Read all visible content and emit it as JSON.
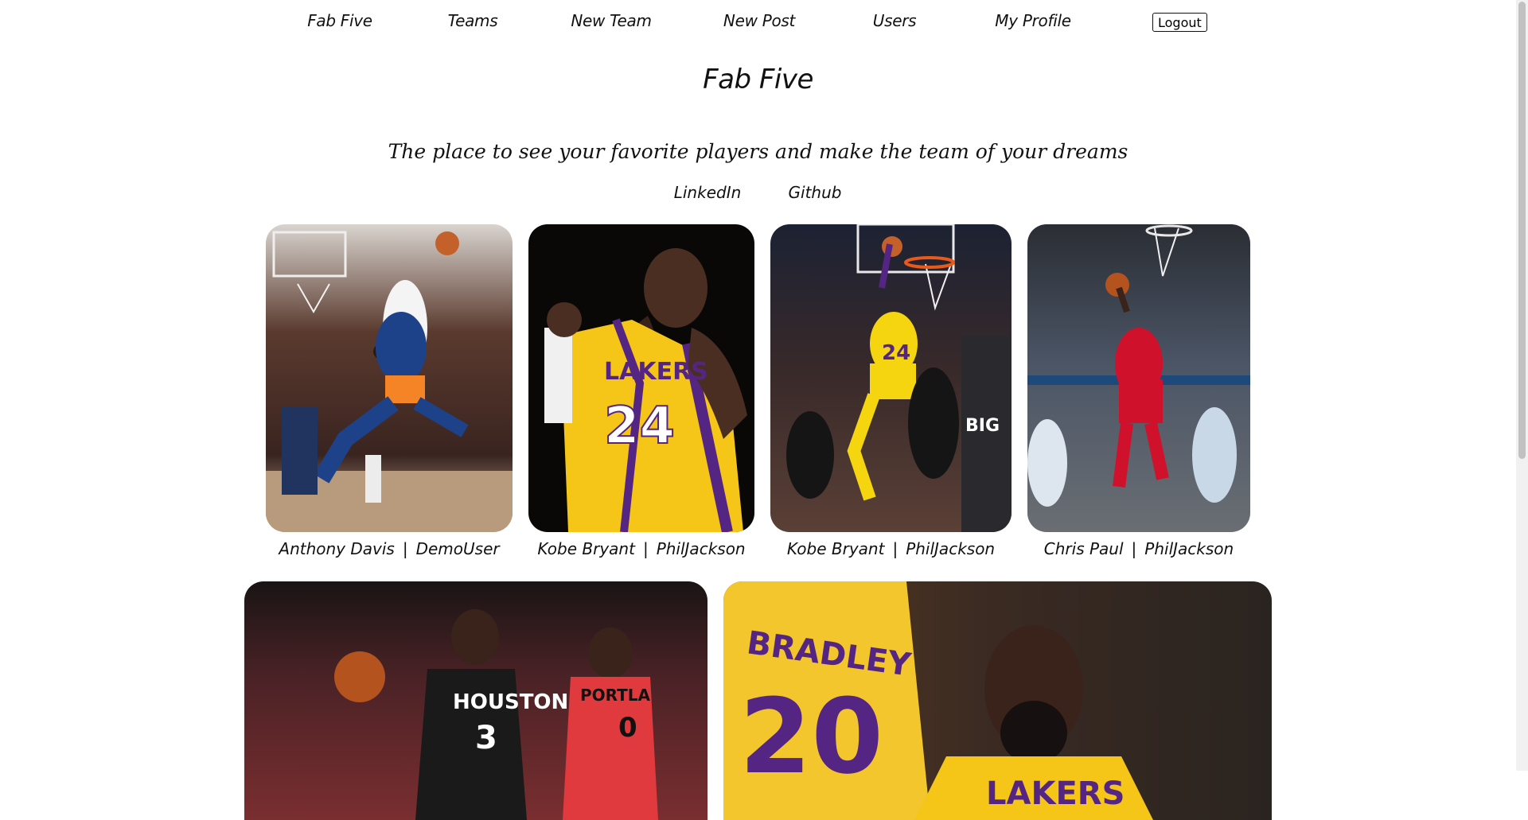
{
  "nav": {
    "items": [
      {
        "label": "Fab Five"
      },
      {
        "label": "Teams"
      },
      {
        "label": "New Team"
      },
      {
        "label": "New Post"
      },
      {
        "label": "Users"
      },
      {
        "label": "My Profile"
      }
    ],
    "logout_label": "Logout"
  },
  "header": {
    "title": "Fab Five",
    "tagline": "The place to see your favorite players and make the team of your dreams"
  },
  "links": {
    "linkedin": "LinkedIn",
    "github": "Github"
  },
  "separator": "|",
  "posts": [
    {
      "player": "Anthony Davis",
      "user": "DemoUser",
      "icon": "player-photo-icon"
    },
    {
      "player": "Kobe Bryant",
      "user": "PhilJackson",
      "icon": "player-photo-icon"
    },
    {
      "player": "Kobe Bryant",
      "user": "PhilJackson",
      "icon": "player-photo-icon"
    },
    {
      "player": "Chris Paul",
      "user": "PhilJackson",
      "icon": "player-photo-icon"
    },
    {
      "player": "",
      "user": "",
      "icon": "player-photo-icon"
    },
    {
      "player": "",
      "user": "",
      "icon": "player-photo-icon"
    }
  ],
  "colors": {
    "text": "#111111",
    "background": "#ffffff",
    "knicks_blue": "#1d428a",
    "knicks_orange": "#f58426",
    "lakers_gold": "#f5c518",
    "lakers_purple": "#552583",
    "clippers_red": "#d0112b",
    "rockets_black": "#1a1a1a",
    "blazers_red": "#e03a3e",
    "heat_black": "#151515"
  }
}
